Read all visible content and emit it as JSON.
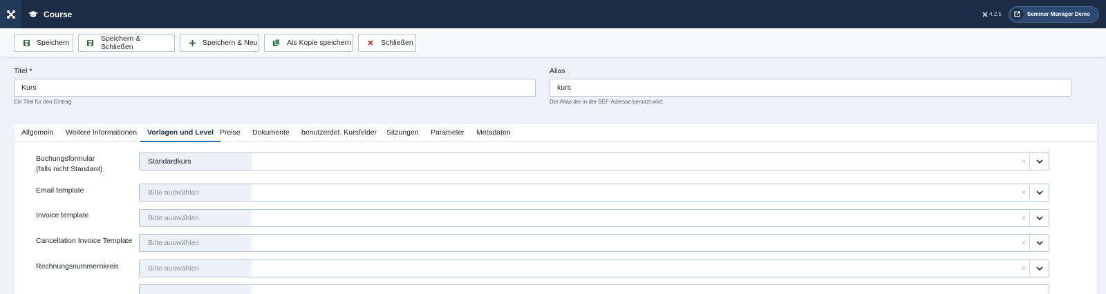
{
  "header": {
    "title": "Course",
    "version": "4.2.5",
    "site_button": "Seminar Manager Demo"
  },
  "toolbar": {
    "save": "Speichern",
    "save_close": "Speichern & Schließen",
    "save_new": "Speichern & Neu",
    "save_copy": "Als Kopie speichern",
    "close": "Schließen"
  },
  "title_field": {
    "label": "Titel *",
    "value": "Kurs",
    "hint": "Ein Titel für den Eintrag"
  },
  "alias_field": {
    "label": "Alias",
    "value": "kurs",
    "hint": "Der Alias der in der SEF-Adresse benutzt wird."
  },
  "tabs": [
    "Allgemein",
    "Weitere Informationen",
    "Vorlagen und Level",
    "Preise",
    "Dokumente",
    "benutzerdef. Kursfelder",
    "Sitzungen",
    "Parameter",
    "Metadaten"
  ],
  "active_tab": "Vorlagen und Level",
  "rows": [
    {
      "label_line1": "Buchungsformular",
      "label_line2": "(falls nicht Standard)",
      "value": "Standardkurs",
      "clear": "×"
    },
    {
      "label_line1": "Email template",
      "value": "Bitte auswählen",
      "clear": "×"
    },
    {
      "label_line1": "Invoice template",
      "value": "Bitte auswählen",
      "clear": "×"
    },
    {
      "label_line1": "Cancellation Invoice Template",
      "value": "Bitte auswählen",
      "clear": "×"
    },
    {
      "label_line1": "Rechnungsnummernkreis",
      "value": "Bitte auswählen",
      "clear": "×"
    }
  ],
  "colors": {
    "header_bg": "#1c2c45",
    "save_icon": "#2f6f3f",
    "close_icon": "#c0282d",
    "active_tab_border": "#2a69b8"
  }
}
